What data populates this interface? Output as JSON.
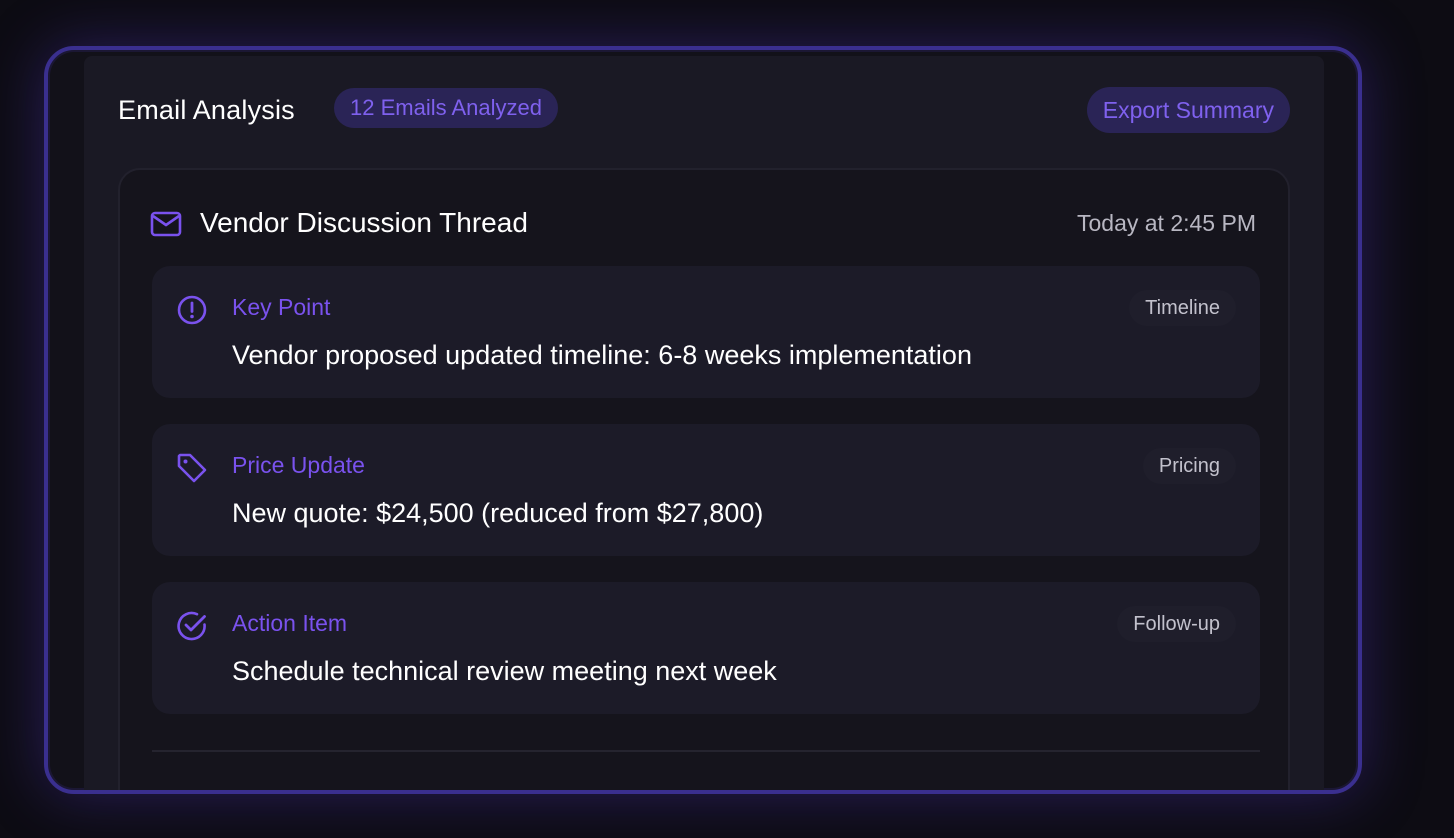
{
  "header": {
    "title": "Email Analysis",
    "count_badge": "12 Emails Analyzed",
    "export_label": "Export Summary"
  },
  "thread": {
    "icon": "mail-icon",
    "title": "Vendor Discussion Thread",
    "time": "Today at 2:45 PM"
  },
  "items": [
    {
      "icon": "alert-circle-icon",
      "label": "Key Point",
      "tag": "Timeline",
      "text": "Vendor proposed updated timeline: 6-8 weeks implementation"
    },
    {
      "icon": "tag-icon",
      "label": "Price Update",
      "tag": "Pricing",
      "text": "New quote: $24,500 (reduced from $27,800)"
    },
    {
      "icon": "check-circle-icon",
      "label": "Action Item",
      "tag": "Follow-up",
      "text": "Schedule technical review meeting next week"
    }
  ],
  "colors": {
    "accent": "#7a52ee",
    "badge_bg": "#2a2456",
    "frame_border": "#3a2f8f"
  }
}
